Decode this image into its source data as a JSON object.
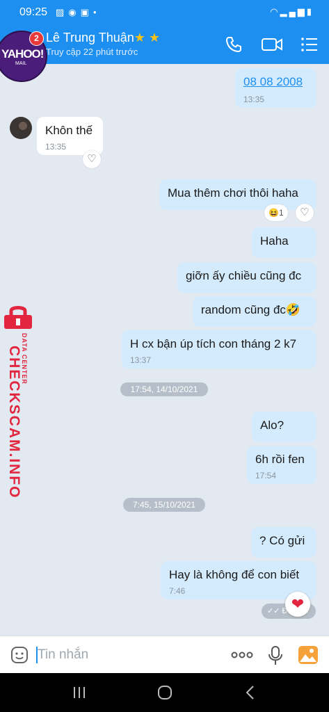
{
  "status_bar": {
    "time": "09:25",
    "dot": "•"
  },
  "header": {
    "avatar_text": "YAHOO!",
    "avatar_sub": "MAIL",
    "badge": "2",
    "name": "Lê Trung Thuận",
    "stars": "★ ★",
    "subtitle": "Truy cập 22 phút trước"
  },
  "messages": [
    {
      "text": "08 08 2008",
      "time": "13:35"
    },
    {
      "text": "Khôn thế",
      "time": "13:35"
    },
    {
      "text": "Mua thêm chơi thôi haha",
      "reaction_count": "1"
    },
    {
      "text": "Haha"
    },
    {
      "text": "giỡn ấy chiều cũng đc"
    },
    {
      "text": "random cũng đc🤣"
    },
    {
      "text": "H cx bận úp tích con tháng 2 k7",
      "time": "13:37"
    },
    {
      "text": "Alo?"
    },
    {
      "text": "6h rồi fen",
      "time": "17:54"
    },
    {
      "text": "? Có gửi"
    },
    {
      "text": "Hay là không để con biết",
      "time": "7:46"
    }
  ],
  "separators": [
    "17:54, 14/10/2021",
    "7:45, 15/10/2021"
  ],
  "seen_label": "Đã xem",
  "input": {
    "placeholder": "Tin nhắn"
  },
  "watermark": {
    "brand": "CHECKSCAM.INFO",
    "tag": "DATA CENTER"
  },
  "colors": {
    "accent": "#1d8ff0",
    "outgoing_bubble": "#d4ebfd",
    "background": "#e2e9f1",
    "watermark": "#e3263f"
  }
}
